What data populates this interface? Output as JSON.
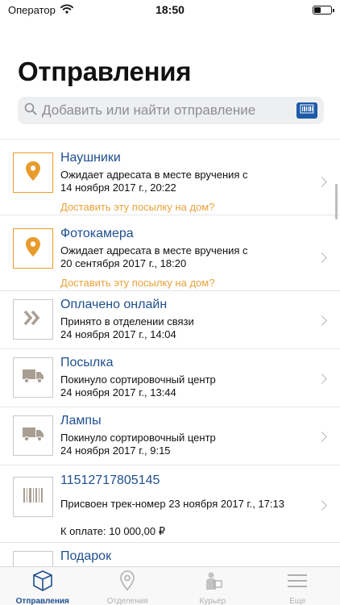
{
  "status_bar": {
    "carrier": "Оператор",
    "time": "18:50",
    "battery_level": 0.35
  },
  "page_title": "Отправления",
  "search": {
    "placeholder": "Добавить или найти отправление"
  },
  "items": [
    {
      "icon": "location-pin-icon",
      "title": "Наушники",
      "status_line1": "Ожидает адресата в месте вручения с",
      "status_line2": "14 ноября 2017 г., 20:22",
      "action": "Доставить эту посылку на дом?"
    },
    {
      "icon": "location-pin-icon",
      "title": "Фотокамера",
      "status_line1": "Ожидает адресата в месте вручения с",
      "status_line2": "20 сентября 2017 г., 18:20",
      "action": "Доставить эту посылку на дом?"
    },
    {
      "icon": "double-chevron-icon",
      "title": "Оплачено онлайн",
      "status_line1": "Принято в отделении связи",
      "status_line2": "24 ноября 2017 г., 14:04"
    },
    {
      "icon": "truck-icon",
      "title": "Посылка",
      "status_line1": "Покинуло сортировочный центр",
      "status_line2": "24 ноября 2017 г., 13:44"
    },
    {
      "icon": "truck-icon",
      "title": "Лампы",
      "status_line1": "Покинуло сортировочный центр",
      "status_line2": "24 ноября 2017 г., 9:15"
    },
    {
      "icon": "barcode-icon",
      "title": "11512717805145",
      "status_line1": "Присвоен трек-номер 23 ноября 2017 г., 17:13",
      "amount": "К оплате: 10 000,00 ₽"
    },
    {
      "icon": "package-icon",
      "title": "Подарок"
    }
  ],
  "tabs": [
    {
      "label": "Отправления",
      "icon": "package-box-icon",
      "active": true
    },
    {
      "label": "Отделения",
      "icon": "map-pin-icon",
      "active": false
    },
    {
      "label": "Курьер",
      "icon": "courier-icon",
      "active": false
    },
    {
      "label": "Еще",
      "icon": "menu-icon",
      "active": false
    }
  ],
  "colors": {
    "accent_blue": "#1e4f8f",
    "action_orange": "#e9a23b",
    "pin_orange": "#e99a2c",
    "icon_gray": "#a89e92"
  }
}
